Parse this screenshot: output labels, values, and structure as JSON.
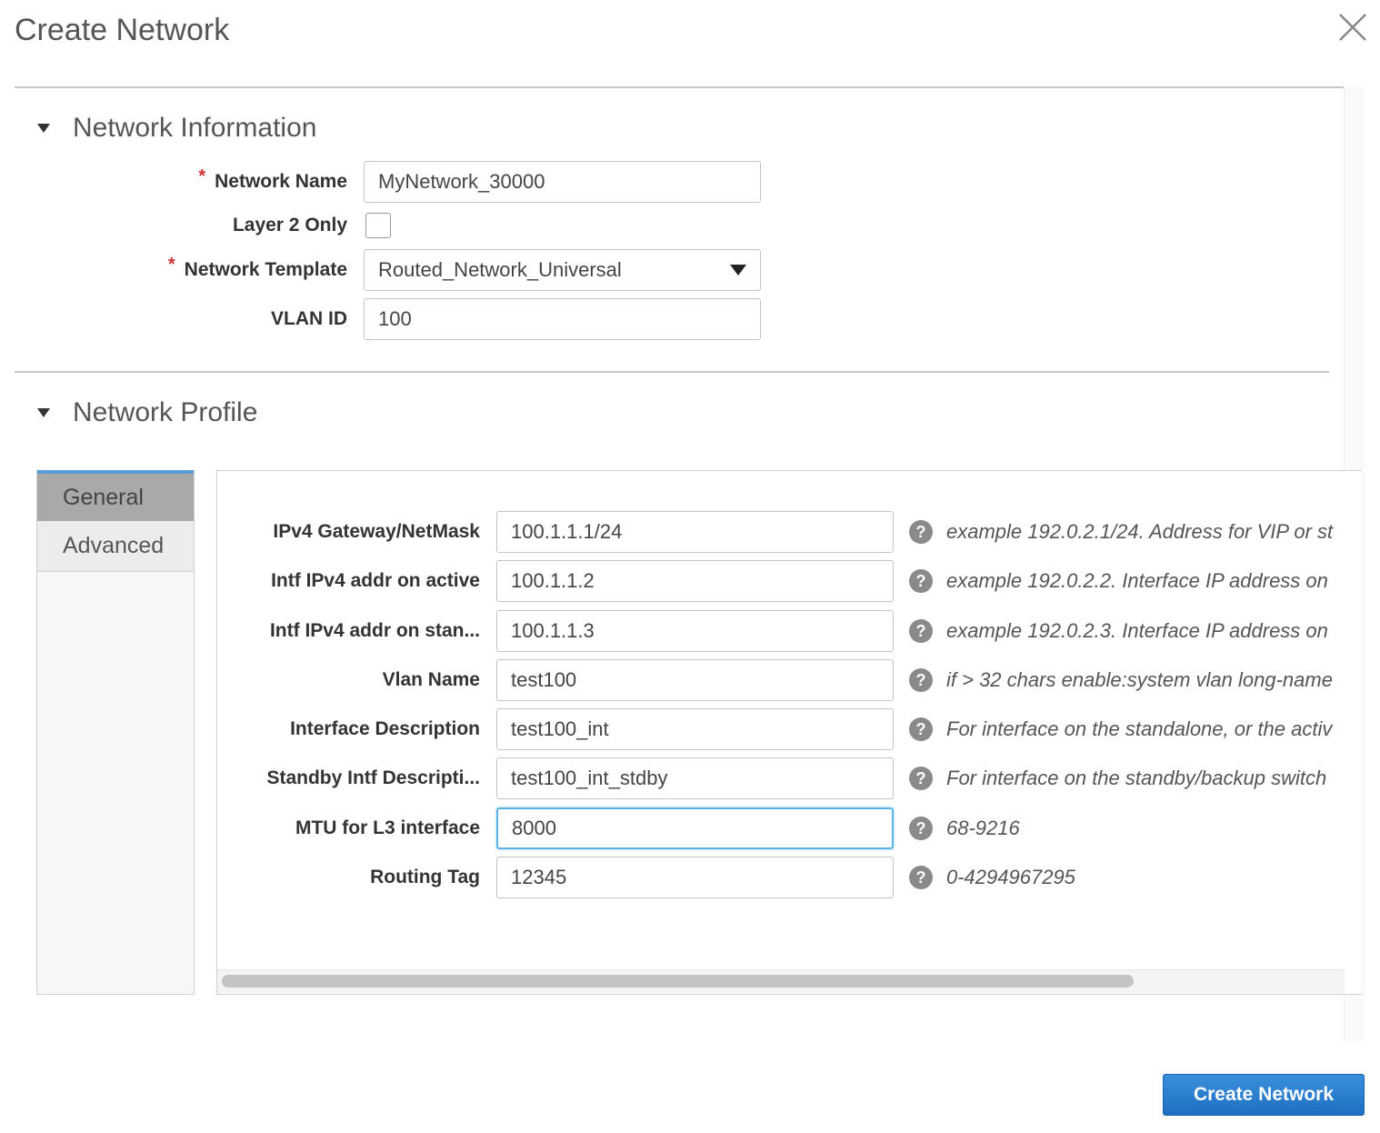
{
  "dialog": {
    "title": "Create Network",
    "close_icon": "close-icon"
  },
  "network_information": {
    "title": "Network Information",
    "fields": {
      "network_name": {
        "label": "Network Name",
        "required": true,
        "value": "MyNetwork_30000"
      },
      "layer2_only": {
        "label": "Layer 2 Only",
        "checked": false
      },
      "network_template": {
        "label": "Network Template",
        "required": true,
        "value": "Routed_Network_Universal"
      },
      "vlan_id": {
        "label": "VLAN ID",
        "value": "100"
      }
    }
  },
  "network_profile": {
    "title": "Network Profile",
    "tabs": [
      {
        "label": "General",
        "active": true
      },
      {
        "label": "Advanced",
        "active": false
      }
    ],
    "fields": [
      {
        "label": "IPv4 Gateway/NetMask",
        "value": "100.1.1.1/24",
        "help": "example 192.0.2.1/24. Address for VIP or st"
      },
      {
        "label": "Intf IPv4 addr on active",
        "value": "100.1.1.2",
        "help": "example 192.0.2.2. Interface IP address on"
      },
      {
        "label": "Intf IPv4 addr on stan...",
        "value": "100.1.1.3",
        "help": "example 192.0.2.3. Interface IP address on"
      },
      {
        "label": "Vlan Name",
        "value": "test100",
        "help": "if > 32 chars enable:system vlan long-name"
      },
      {
        "label": "Interface Description",
        "value": "test100_int",
        "help": "For interface on the standalone, or the activ"
      },
      {
        "label": "Standby Intf Descripti...",
        "value": "test100_int_stdby",
        "help": "For interface on the standby/backup switch"
      },
      {
        "label": "MTU for L3 interface",
        "value": "8000",
        "help": "68-9216",
        "focused": true
      },
      {
        "label": "Routing Tag",
        "value": "12345",
        "help": "0-4294967295"
      }
    ]
  },
  "footer": {
    "create_button": "Create Network"
  },
  "colors": {
    "primary": "#1e6fc2",
    "required": "#d0312d",
    "focus": "#5ab3e6"
  }
}
